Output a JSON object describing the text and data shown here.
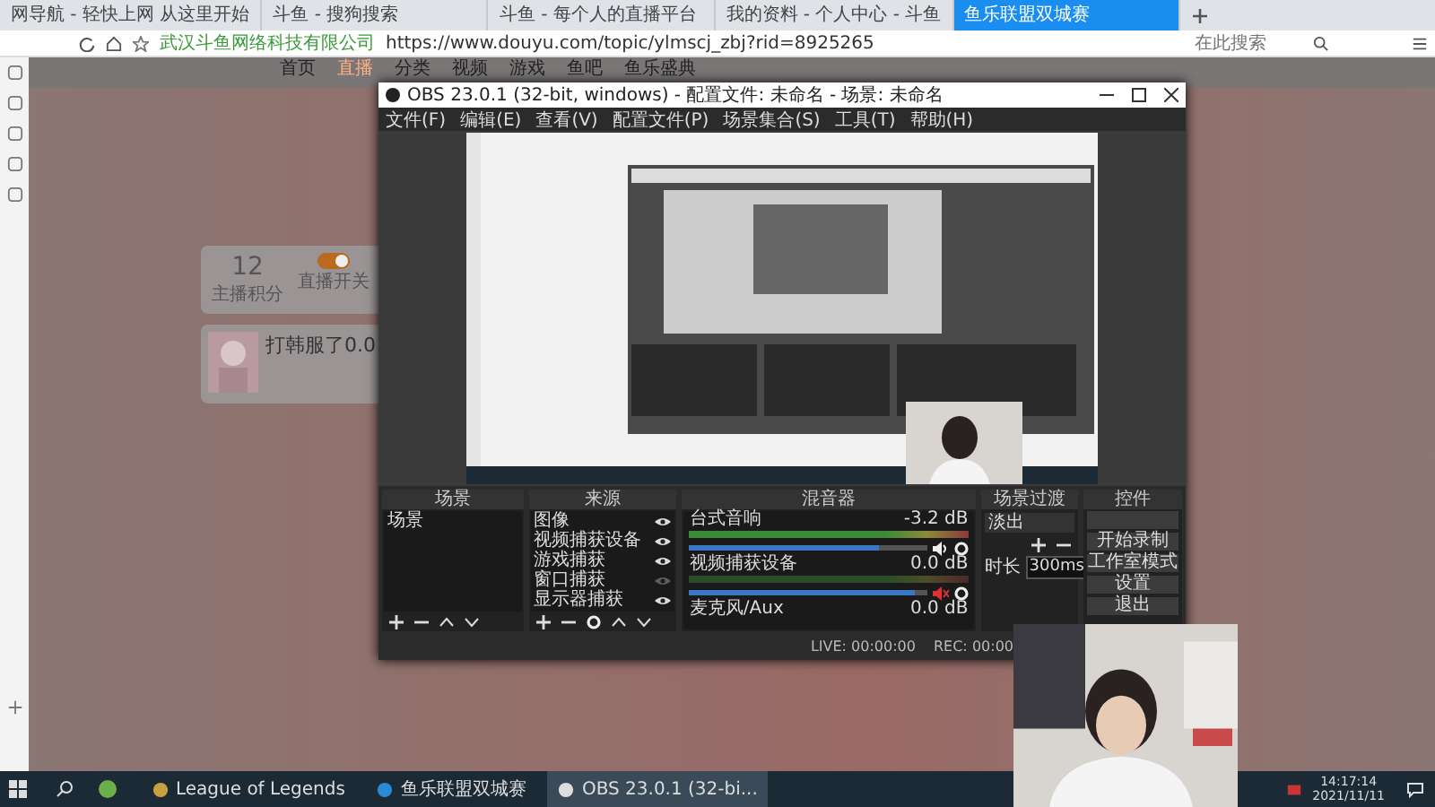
{
  "browser": {
    "tabs": [
      {
        "label": "网导航 - 轻快上网 从这里开始",
        "selected": false
      },
      {
        "label": "斗鱼 - 搜狗搜索",
        "selected": false
      },
      {
        "label": "斗鱼 - 每个人的直播平台",
        "selected": false
      },
      {
        "label": "我的资料 - 个人中心 - 斗鱼",
        "selected": false
      },
      {
        "label": "鱼乐联盟双城赛",
        "selected": true
      }
    ],
    "site_label": "武汉斗鱼网络科技有限公司",
    "url": "https://www.douyu.com/topic/ylmscj_zbj?rid=8925265",
    "search": {
      "placeholder": "在此搜索"
    }
  },
  "page": {
    "nav": [
      {
        "label": "首页",
        "selected": false
      },
      {
        "label": "直播",
        "selected": true
      },
      {
        "label": "分类",
        "selected": false
      },
      {
        "label": "视频",
        "selected": false
      },
      {
        "label": "游戏",
        "selected": false
      },
      {
        "label": "鱼吧",
        "selected": false
      },
      {
        "label": "鱼乐盛典",
        "selected": false
      }
    ],
    "stats": {
      "value": "12",
      "label": "主播积分",
      "switch_label": "直播开关",
      "switch_on": true
    },
    "room_title": "打韩服了0.0"
  },
  "obs": {
    "title": "OBS 23.0.1 (32-bit, windows) - 配置文件: 未命名 - 场景: 未命名",
    "menu": [
      "文件(F)",
      "编辑(E)",
      "查看(V)",
      "配置文件(P)",
      "场景集合(S)",
      "工具(T)",
      "帮助(H)"
    ],
    "scenes": {
      "title": "场景",
      "items": [
        {
          "label": "场景",
          "selected": false
        }
      ]
    },
    "sources": {
      "title": "来源",
      "items": [
        {
          "label": "图像",
          "visible": true
        },
        {
          "label": "视频捕获设备",
          "visible": true
        },
        {
          "label": "游戏捕获",
          "visible": true
        },
        {
          "label": "窗口捕获",
          "visible": false
        },
        {
          "label": "显示器捕获",
          "visible": true
        }
      ]
    },
    "mixer": {
      "title": "混音器",
      "channels": [
        {
          "name": "台式音响",
          "reading": "-3.2 dB",
          "level": 0.8,
          "muted": false
        },
        {
          "name": "视频捕获设备",
          "reading": "0.0 dB",
          "level": 0.95,
          "muted": true
        },
        {
          "name": "麦克风/Aux",
          "reading": "0.0 dB"
        }
      ]
    },
    "transitions": {
      "title": "场景过渡",
      "type": "淡出",
      "duration_label": "时长",
      "duration": "300ms"
    },
    "controls": {
      "title": "控件",
      "buttons": [
        "开始录制",
        "工作室模式",
        "设置",
        "退出"
      ]
    },
    "status": [
      {
        "label": "LIVE:",
        "value": "00:00:00"
      },
      {
        "label": "REC:",
        "value": "00:00"
      }
    ]
  },
  "taskbar": {
    "apps": [
      {
        "label": "League of Legends",
        "selected": false
      },
      {
        "label": "鱼乐联盟双城赛",
        "selected": false
      },
      {
        "label": "OBS 23.0.1 (32-bi...",
        "selected": true
      }
    ],
    "time": "14:17:14",
    "date": "2021/11/11"
  }
}
